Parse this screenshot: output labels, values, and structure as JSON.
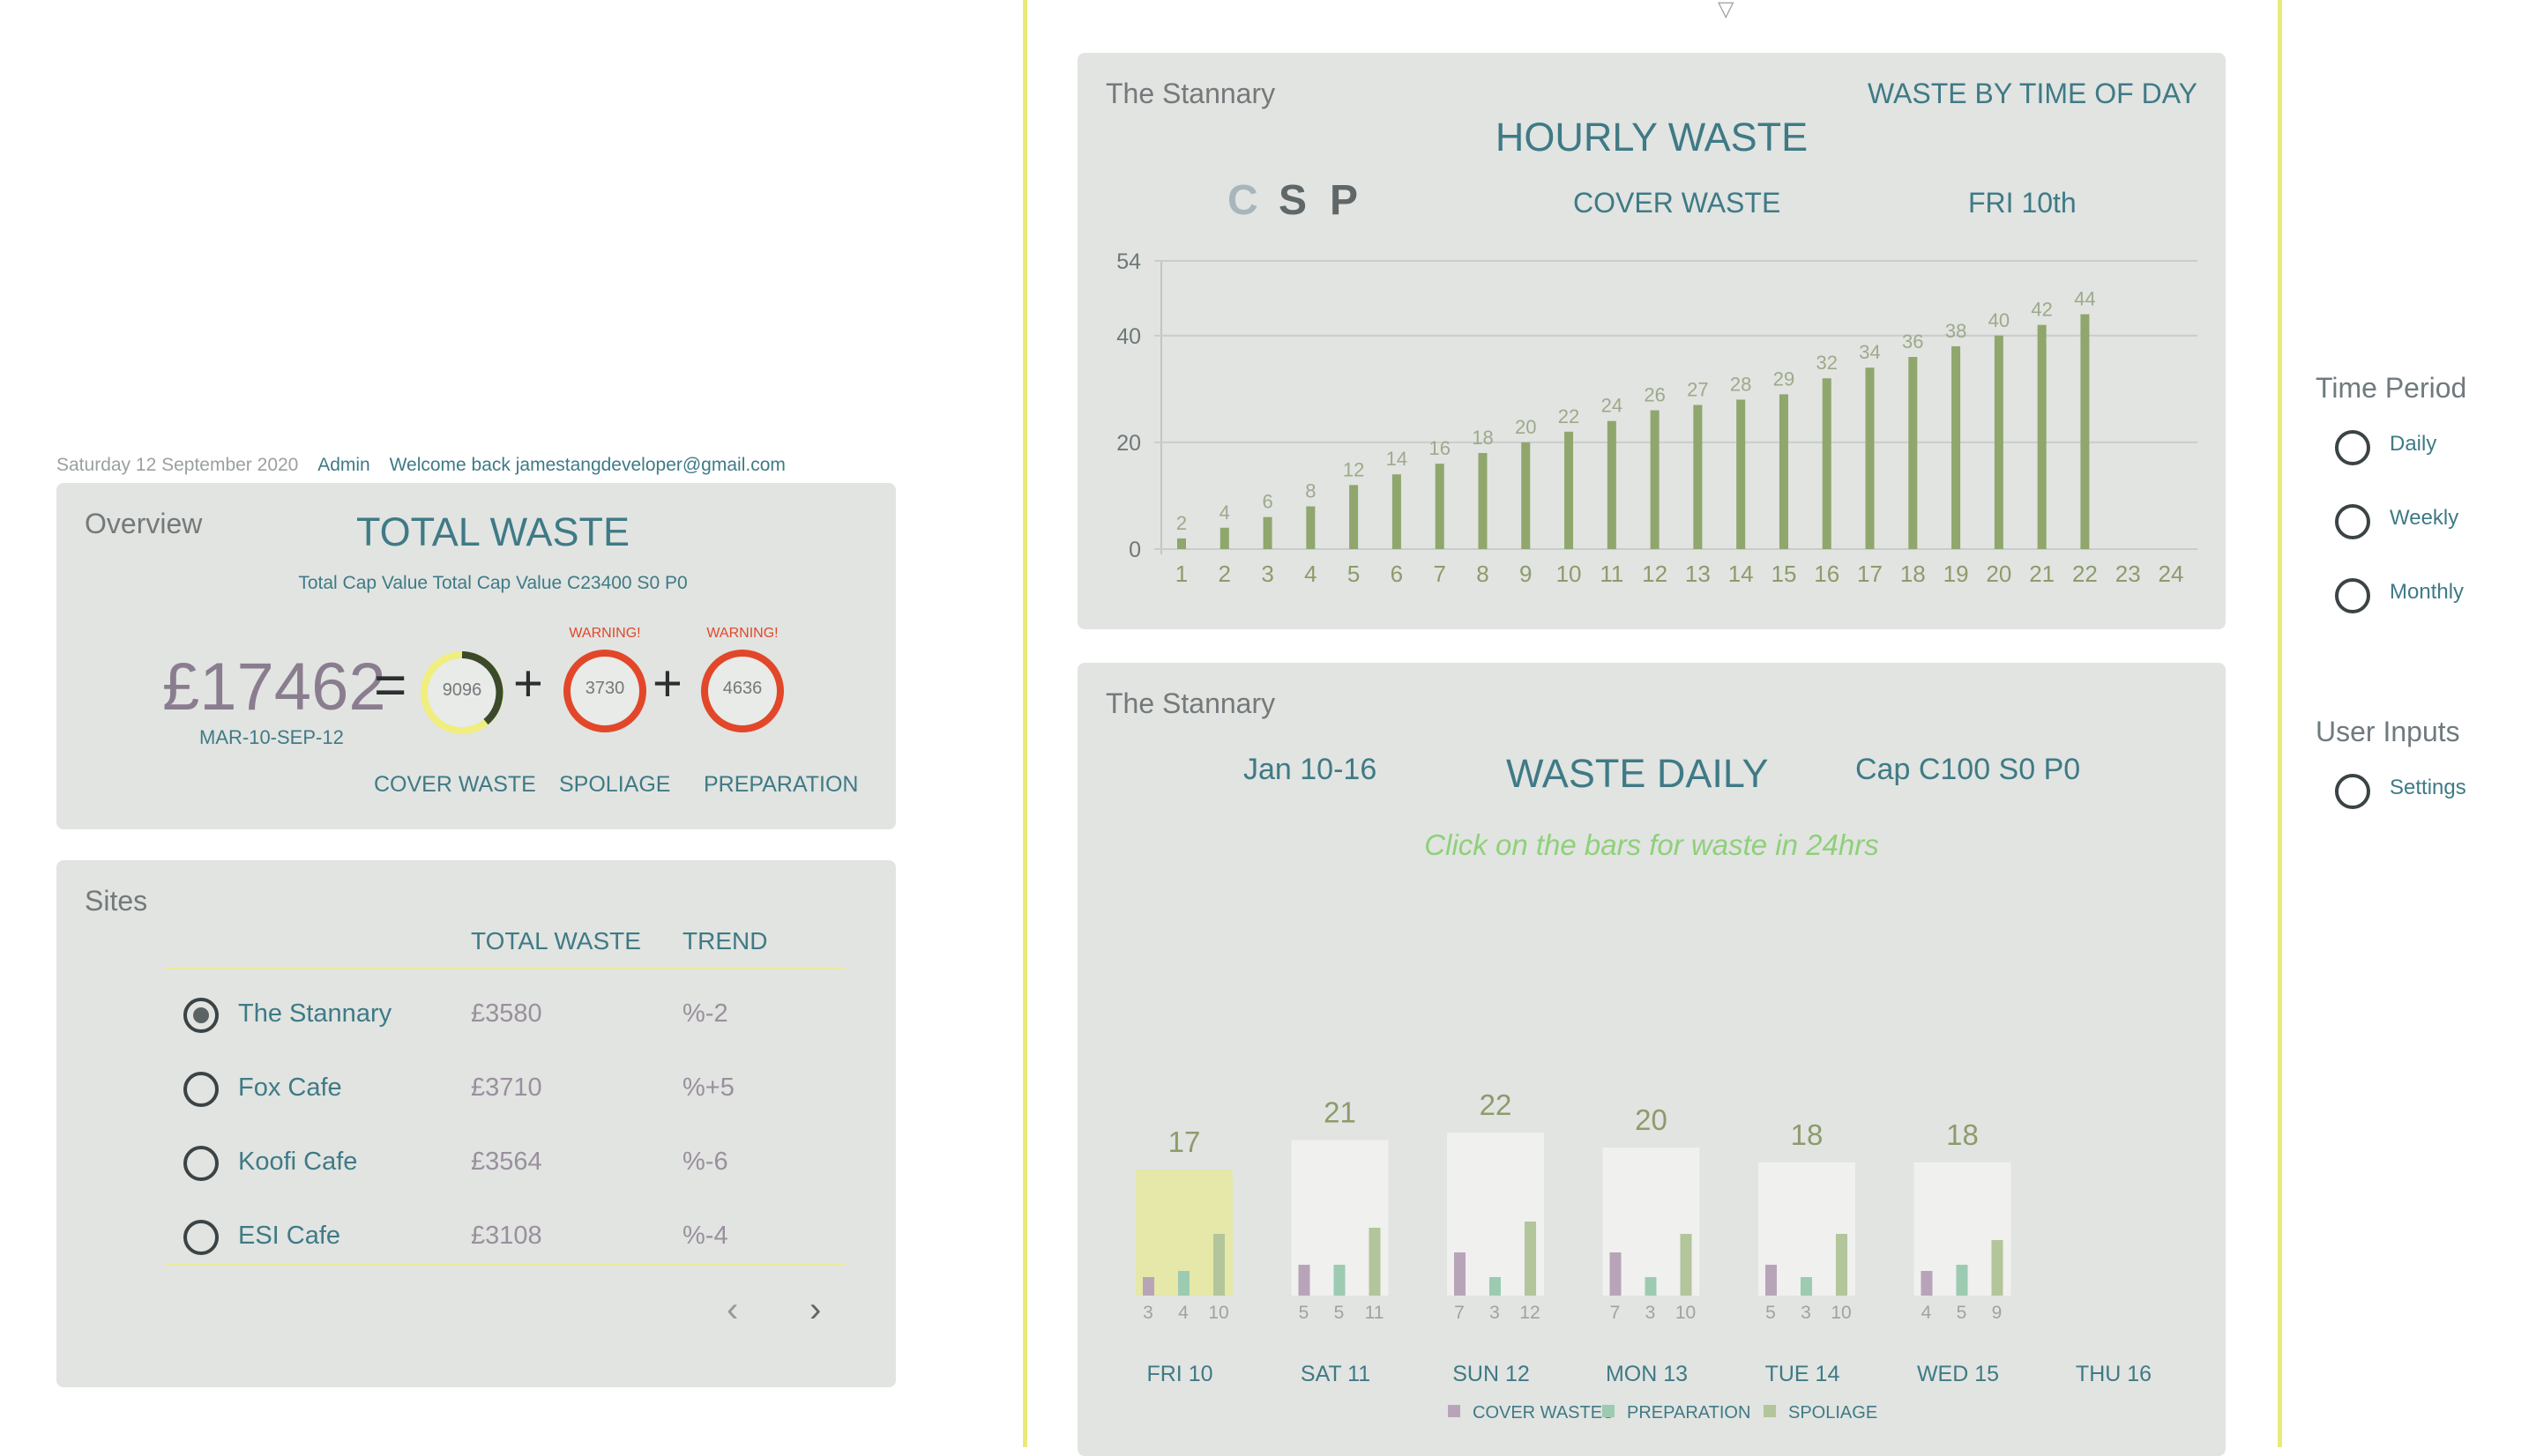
{
  "header": {
    "date": "Saturday 12 September 2020",
    "role": "Admin",
    "welcome": "Welcome back jamestangdeveloper@gmail.com"
  },
  "overview": {
    "label": "Overview",
    "title": "TOTAL WASTE",
    "cap_value": "Total Cap Value Total Cap Value C23400 S0 P0",
    "total_value": "£17462",
    "date_range": "MAR-10-SEP-12",
    "equals": "=",
    "plus": "+",
    "cover_waste": {
      "value": "9096",
      "label": "COVER WASTE"
    },
    "spoliage": {
      "value": "3730",
      "label": "SPOLIAGE",
      "warning": "WARNING!"
    },
    "preparation": {
      "value": "4636",
      "label": "PREPARATION",
      "warning": "WARNING!"
    },
    "colors": {
      "ring_yellow": "#f0ee7e",
      "ring_dark": "#3b4a2a",
      "ring_red": "#e2472a"
    }
  },
  "sites": {
    "label": "Sites",
    "col_total": "TOTAL WASTE",
    "col_trend": "TREND",
    "rows": [
      {
        "name": "The Stannary",
        "total": "£3580",
        "trend": "%-2",
        "selected": true
      },
      {
        "name": "Fox Cafe",
        "total": "£3710",
        "trend": "%+5",
        "selected": false
      },
      {
        "name": "Koofi Cafe",
        "total": "£3564",
        "trend": "%-6",
        "selected": false
      },
      {
        "name": "ESI Cafe",
        "total": "£3108",
        "trend": "%-4",
        "selected": false
      }
    ],
    "prev_icon": "chevron-left-icon",
    "next_icon": "chevron-right-icon"
  },
  "hourly": {
    "site": "The Stannary",
    "subtitle": "WASTE BY TIME OF DAY",
    "title": "HOURLY WASTE",
    "toggles": [
      "C",
      "S",
      "P"
    ],
    "waste_type": "COVER WASTE",
    "day": "FRI 10th"
  },
  "daily": {
    "site": "The Stannary",
    "range": "Jan 10-16",
    "title": "WASTE DAILY",
    "cap": "Cap C100 S0 P0",
    "hint": "Click on the bars for waste in 24hrs",
    "legend": [
      "COVER WASTES",
      "PREPARATION",
      "SPOLIAGE"
    ]
  },
  "sidebar": {
    "time_period": "Time Period",
    "options": [
      "Daily",
      "Weekly",
      "Monthly"
    ],
    "user_inputs": "User Inputs",
    "settings": "Settings"
  },
  "chart_data": [
    {
      "type": "bar",
      "title": "HOURLY WASTE",
      "categories": [
        "1",
        "2",
        "3",
        "4",
        "5",
        "6",
        "7",
        "8",
        "9",
        "10",
        "11",
        "12",
        "13",
        "14",
        "15",
        "16",
        "17",
        "18",
        "19",
        "20",
        "21",
        "22",
        "23",
        "24"
      ],
      "values": [
        2,
        4,
        6,
        8,
        12,
        14,
        16,
        18,
        20,
        22,
        24,
        26,
        27,
        28,
        29,
        32,
        34,
        36,
        38,
        40,
        42,
        44,
        null,
        null
      ],
      "yticks": [
        0,
        20,
        40,
        54
      ],
      "ylim": [
        0,
        54
      ],
      "grid": true,
      "color": "#8fa66d"
    },
    {
      "type": "bar",
      "title": "WASTE DAILY",
      "categories": [
        "FRI 10",
        "SAT 11",
        "SUN 12",
        "MON 13",
        "TUE 14",
        "WED 15",
        "THU 16"
      ],
      "totals": [
        17,
        21,
        22,
        20,
        18,
        18,
        null
      ],
      "series": [
        {
          "name": "COVER WASTES",
          "values": [
            3,
            5,
            7,
            7,
            5,
            4,
            null
          ],
          "color": "#b8a4b9"
        },
        {
          "name": "PREPARATION",
          "values": [
            4,
            5,
            3,
            3,
            3,
            5,
            null
          ],
          "color": "#9ccbb2"
        },
        {
          "name": "SPOLIAGE",
          "values": [
            10,
            11,
            12,
            10,
            10,
            9,
            null
          ],
          "color": "#b3c59a"
        }
      ],
      "highlight_color": "#e5e8a8",
      "box_color": "#f0f0ef"
    }
  ]
}
